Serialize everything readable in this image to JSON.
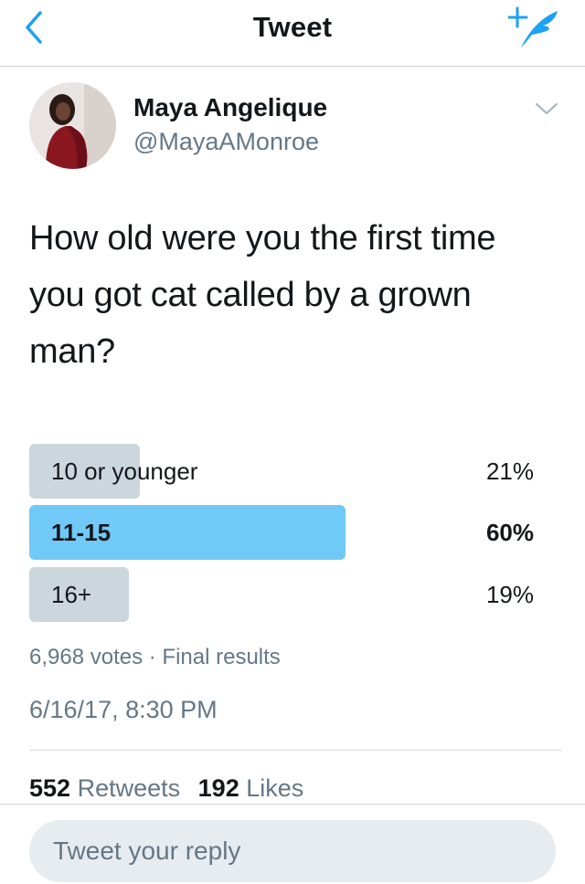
{
  "header": {
    "title": "Tweet",
    "back_icon": "back-chevron-icon",
    "compose_icon": "compose-tweet-icon",
    "accent_color": "#1da1f2"
  },
  "tweet": {
    "author": {
      "display_name": "Maya Angelique",
      "handle": "@MayaAMonroe"
    },
    "text": "How old were you the first time you got cat called by a grown man?",
    "poll": {
      "options": [
        {
          "label": "10 or younger",
          "percent_label": "21%",
          "percent": 21,
          "winner": false
        },
        {
          "label": "11-15",
          "percent_label": "60%",
          "percent": 60,
          "winner": true
        },
        {
          "label": "16+",
          "percent_label": "19%",
          "percent": 19,
          "winner": false
        }
      ],
      "meta": "6,968 votes · Final results",
      "bar_color": "#ccd6dd",
      "winner_color": "#71c9f8"
    },
    "timestamp": "6/16/17, 8:30 PM",
    "stats": {
      "retweets_count": "552",
      "retweets_label": "Retweets",
      "likes_count": "192",
      "likes_label": "Likes"
    }
  },
  "reply": {
    "placeholder": "Tweet your reply"
  }
}
